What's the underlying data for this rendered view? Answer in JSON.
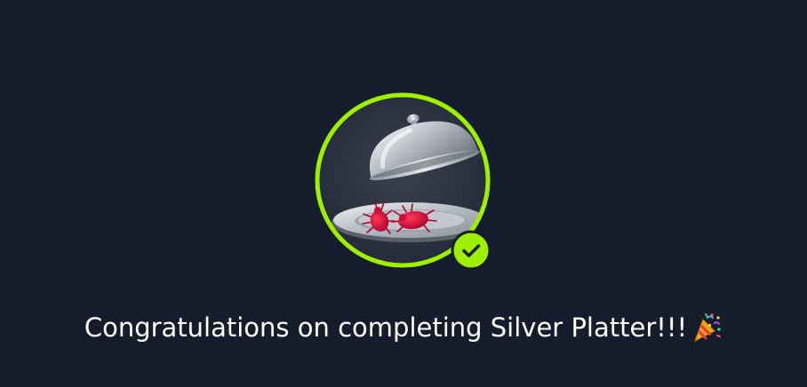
{
  "completion": {
    "message": "Congratulations on completing Silver Platter!!!",
    "emoji_icon": "party-popper-icon",
    "badge_icon": "silver-platter-cloche-with-bugs-icon",
    "status_icon": "checkmark-icon"
  },
  "colors": {
    "background": "#151c2b",
    "badge_ring": "#9fef00",
    "badge_inner": "#2f3541",
    "check_fill": "#9fef00",
    "check_mark": "#151c2b",
    "text": "#ffffff"
  }
}
